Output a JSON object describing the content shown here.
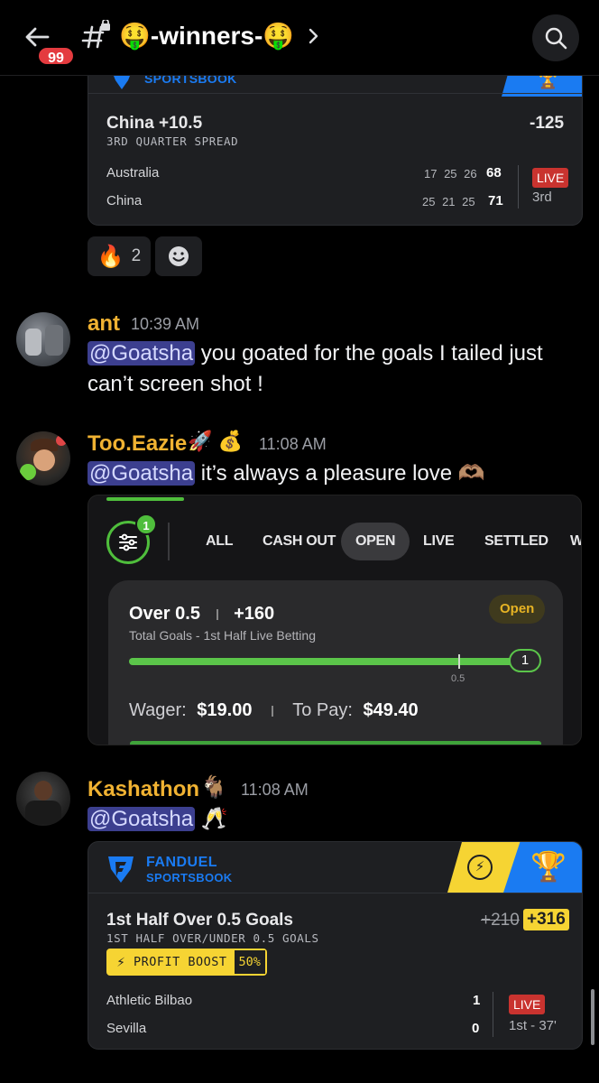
{
  "header": {
    "badge_count": "99",
    "channel_name": "🤑-winners-🤑"
  },
  "card1": {
    "brand_partial": "SPORTSBOOK",
    "title": "China +10.5",
    "subtitle": "3RD QUARTER SPREAD",
    "odds": "-125",
    "rows": [
      {
        "team": "Australia",
        "quarters": "17 25 26",
        "total": "68"
      },
      {
        "team": "China",
        "quarters": "25 21 25",
        "total": "71"
      }
    ],
    "live_label": "LIVE",
    "period": "3rd"
  },
  "reactions": [
    {
      "emoji": "🔥",
      "count": "2"
    }
  ],
  "messages": [
    {
      "username": "ant",
      "timestamp": "10:39 AM",
      "mention": "@Goatsha",
      "text_line1": " you goated for the goals I tailed just",
      "text_line2": "can’t screen shot !",
      "color": "#f0b232"
    },
    {
      "username": "Too.Eazie",
      "user_emoji": "🚀 💰",
      "timestamp": "11:08 AM",
      "mention": "@Goatsha",
      "text": " it’s always a pleasure love 🫶🏽",
      "color": "#f0b232"
    },
    {
      "username": "Kashathon",
      "user_emoji": "🐐",
      "timestamp": "11:08 AM",
      "mention": "@Goatsha",
      "text": " 🥂",
      "color": "#f0b232"
    }
  ],
  "screenshot": {
    "filter_count": "1",
    "tabs": [
      "ALL",
      "CASH OUT",
      "OPEN",
      "LIVE",
      "SETTLED",
      "W"
    ],
    "active_tab": "OPEN",
    "bet_title": "Over 0.5",
    "bet_odds": "+160",
    "bet_desc": "Total Goals - 1st Half Live Betting",
    "status": "Open",
    "progress_value": "1",
    "progress_fraction": 1.0,
    "threshold_label": "0.5",
    "wager_label": "Wager:",
    "wager_value": "$19.00",
    "topay_label": "To Pay:",
    "topay_value": "$49.40"
  },
  "card2": {
    "brand_top": "FANDUEL",
    "brand_bottom": "SPORTSBOOK",
    "title": "1st Half Over 0.5 Goals",
    "subtitle": "1ST HALF OVER/UNDER 0.5 GOALS",
    "old_odds": "+210",
    "new_odds": "+316",
    "boost_label": "PROFIT BOOST",
    "boost_pct": "50%",
    "rows": [
      {
        "team": "Athletic Bilbao",
        "score": "1"
      },
      {
        "team": "Sevilla",
        "score": "0"
      }
    ],
    "live_label": "LIVE",
    "period": "1st - 37'"
  },
  "colors": {
    "accent_green": "#4fbe3c",
    "live_red": "#c9332f",
    "boost_yellow": "#f6d433",
    "fanduel_blue": "#1a7bf2",
    "mention_bg": "#3c3f8f",
    "username": "#f0b232"
  }
}
